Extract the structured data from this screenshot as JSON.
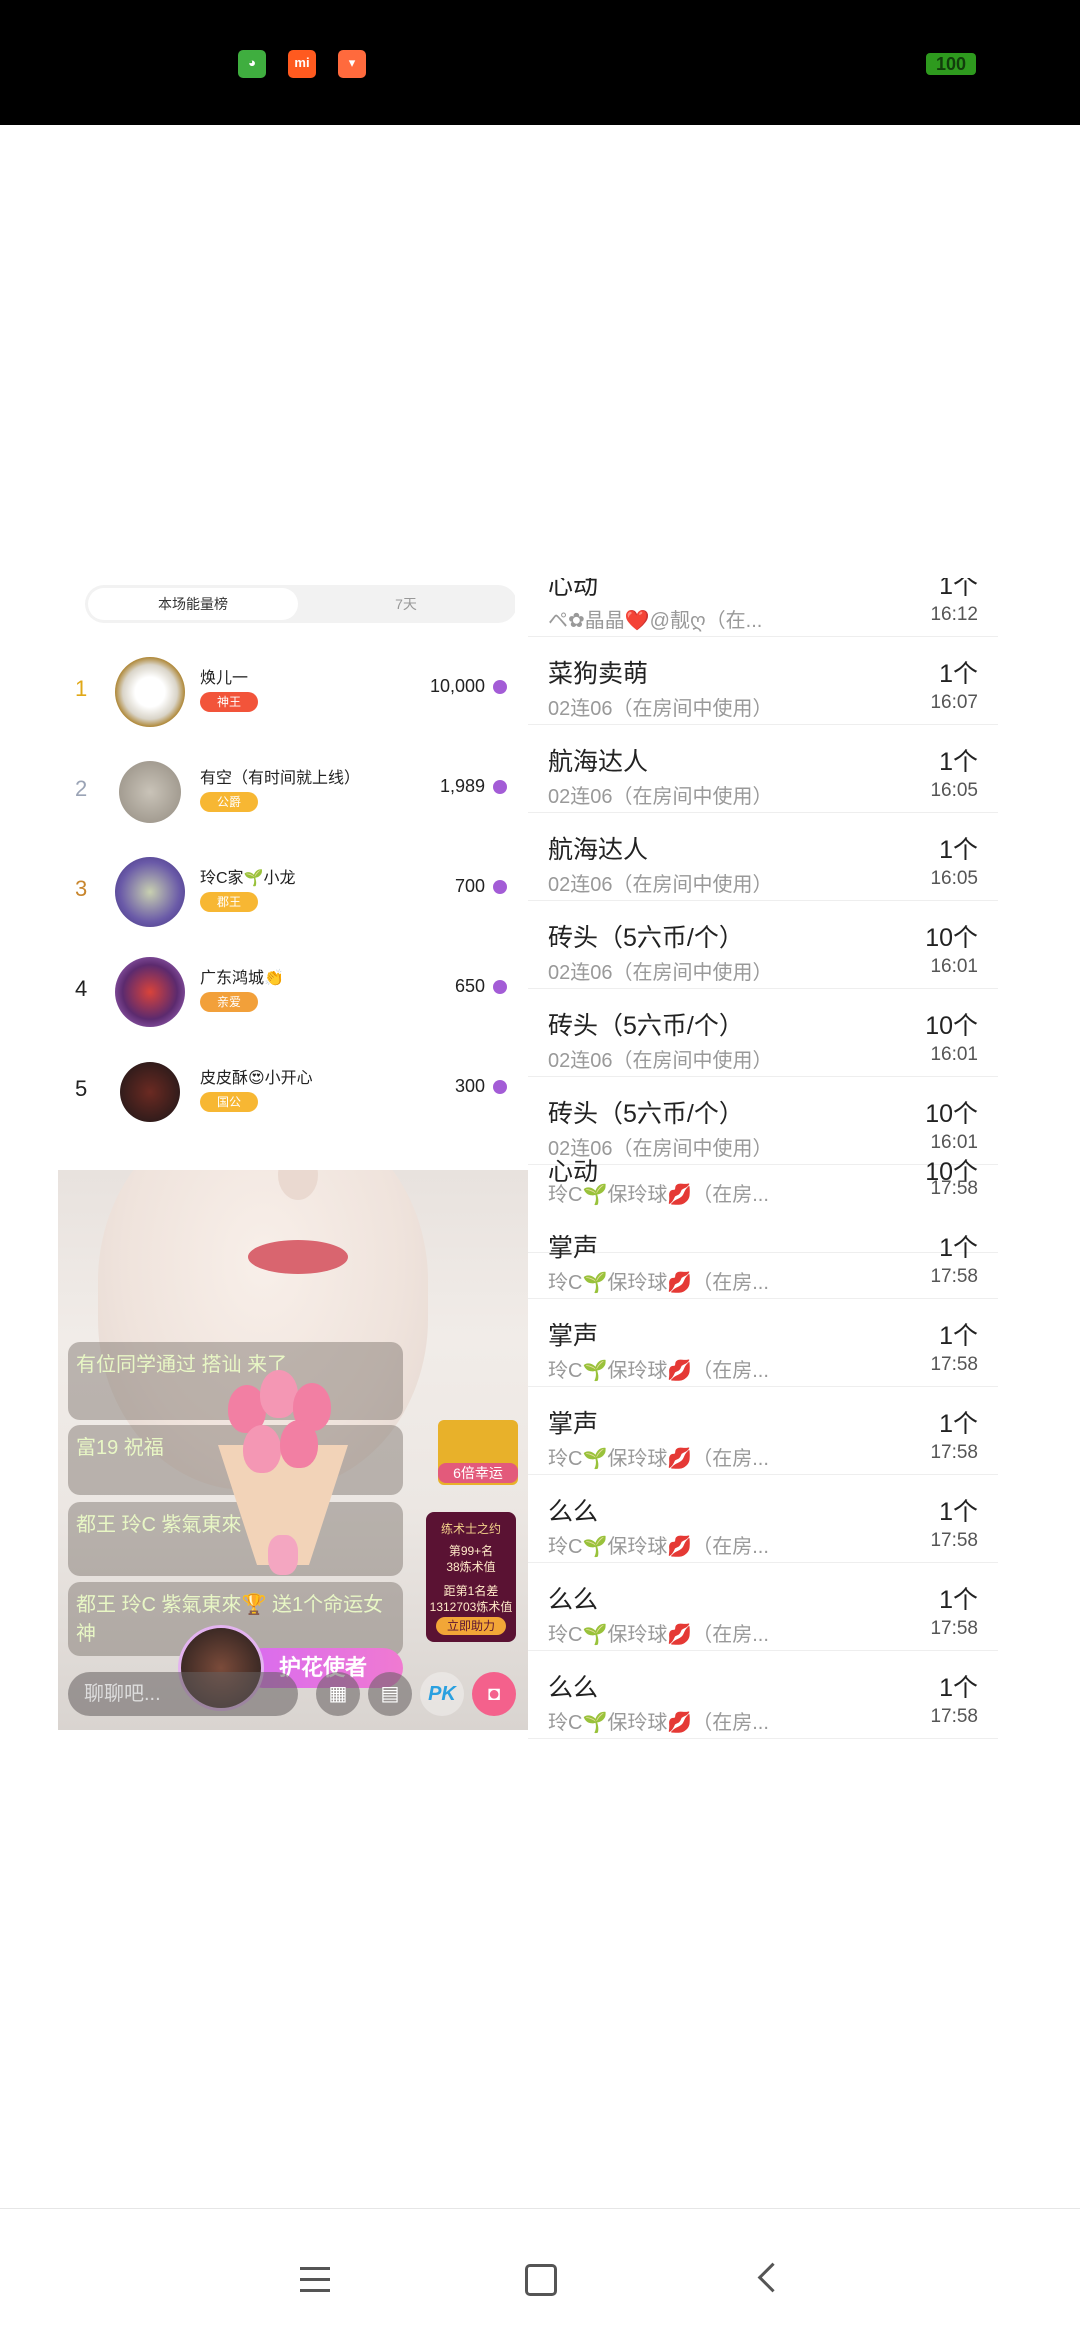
{
  "status_bar": {
    "icons": [
      "wechat-icon",
      "mi-icon",
      "shopping-bag-icon"
    ],
    "mi_label": "mi",
    "battery": "100"
  },
  "ranking": {
    "tabs": [
      "本场能量榜",
      "7天"
    ],
    "rows": [
      {
        "rank": "1",
        "name": "焕儿一",
        "badge": "神王",
        "score": "10,000"
      },
      {
        "rank": "2",
        "name": "有空（有时间就上线）",
        "badge": "公爵",
        "score": "1,989"
      },
      {
        "rank": "3",
        "name": "玲C家🌱小龙",
        "badge": "郡王",
        "score": "700"
      },
      {
        "rank": "4",
        "name": "广东鸿城👏",
        "badge": "亲爱",
        "score": "650"
      },
      {
        "rank": "5",
        "name": "皮皮酥😍小开心",
        "badge": "国公",
        "score": "300"
      }
    ]
  },
  "gift_records": [
    {
      "name": "心动",
      "sub": "ペ✿晶晶❤️@靓ღ（在...",
      "count": "1个",
      "time": "16:12"
    },
    {
      "name": "菜狗卖萌",
      "sub": "02连06（在房间中使用）",
      "count": "1个",
      "time": "16:07"
    },
    {
      "name": "航海达人",
      "sub": "02连06（在房间中使用）",
      "count": "1个",
      "time": "16:05"
    },
    {
      "name": "航海达人",
      "sub": "02连06（在房间中使用）",
      "count": "1个",
      "time": "16:05"
    },
    {
      "name": "砖头（5六币/个）",
      "sub": "02连06（在房间中使用）",
      "count": "10个",
      "time": "16:01"
    },
    {
      "name": "砖头（5六币/个）",
      "sub": "02连06（在房间中使用）",
      "count": "10个",
      "time": "16:01"
    },
    {
      "name": "砖头（5六币/个）",
      "sub": "02连06（在房间中使用）",
      "count": "10个",
      "time": "16:01"
    },
    {
      "name": "心动",
      "sub": "玲C🌱保玲球💋（在房...",
      "count": "10个",
      "time": "17:58"
    },
    {
      "name": "掌声",
      "sub": "玲C🌱保玲球💋（在房...",
      "count": "1个",
      "time": "17:58"
    },
    {
      "name": "掌声",
      "sub": "玲C🌱保玲球💋（在房...",
      "count": "1个",
      "time": "17:58"
    },
    {
      "name": "掌声",
      "sub": "玲C🌱保玲球💋（在房...",
      "count": "1个",
      "time": "17:58"
    },
    {
      "name": "么么",
      "sub": "玲C🌱保玲球💋（在房...",
      "count": "1个",
      "time": "17:58"
    },
    {
      "name": "么么",
      "sub": "玲C🌱保玲球💋（在房...",
      "count": "1个",
      "time": "17:58"
    },
    {
      "name": "么么",
      "sub": "玲C🌱保玲球💋（在房...",
      "count": "1个",
      "time": "17:58"
    }
  ],
  "live": {
    "messages": [
      "有位同学通过 搭讪 来了",
      "富19 祝福",
      "都王 玲C 紫氣東來🏆 一个",
      "都王 玲C 紫氣東來🏆 送1个命运女神"
    ],
    "card_label": "6倍幸运",
    "promo": {
      "title": "练术士之约",
      "line1": "第99+名",
      "line2": "38炼术值",
      "line3": "距第1名差",
      "line4": "1312703炼术值",
      "button": "立即助力"
    },
    "hero_label": "护花使者",
    "chat_placeholder": "聊聊吧...",
    "pk_label": "PK"
  },
  "navbar": {
    "icons": [
      "menu-icon",
      "home-icon",
      "back-icon"
    ]
  }
}
